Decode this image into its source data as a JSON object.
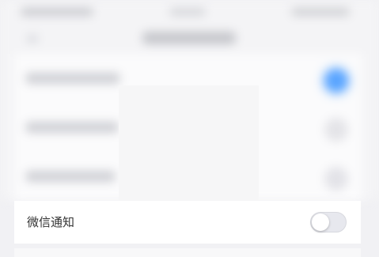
{
  "settings": {
    "wechat_notify": {
      "label": "微信通知",
      "toggle_on": false
    }
  },
  "colors": {
    "toggle_off_track": "#e7e8ee",
    "toggle_knob": "#ffffff",
    "accent_blue": "#5aa5ff"
  }
}
